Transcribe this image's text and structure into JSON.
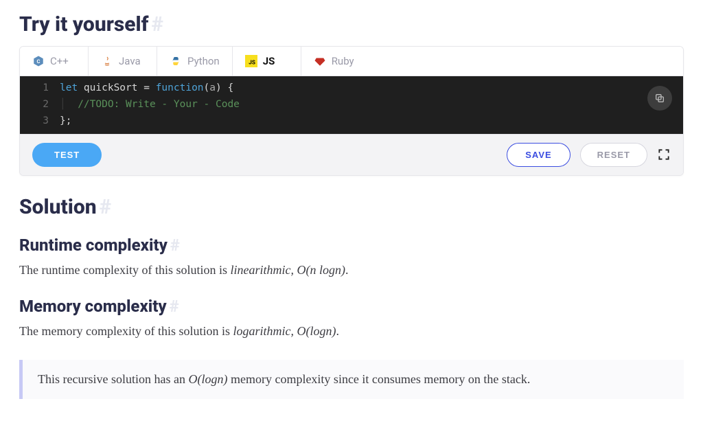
{
  "try_heading": "Try it yourself",
  "tabs": {
    "cpp": "C++",
    "java": "Java",
    "python": "Python",
    "js": "JS",
    "ruby": "Ruby"
  },
  "code": {
    "l1_kw1": "let",
    "l1_name": " quickSort ",
    "l1_eq": "= ",
    "l1_kw2": "function",
    "l1_paren_open": "(",
    "l1_arg": "a",
    "l1_paren_close": ") {",
    "l2_guide": "│  ",
    "l2_comment": "//TODO: Write - Your - Code",
    "l3": "};"
  },
  "buttons": {
    "test": "TEST",
    "save": "SAVE",
    "reset": "RESET"
  },
  "solution_heading": "Solution",
  "runtime_heading": "Runtime complexity",
  "runtime_text_pre": "The runtime complexity of this solution is ",
  "runtime_em": "linearithmic, ",
  "runtime_math": "O(n logn)",
  "runtime_dot": ".",
  "memory_heading": "Memory complexity",
  "memory_text_pre": "The memory complexity of this solution is ",
  "memory_em": "logarithmic, ",
  "memory_math": "O(logn)",
  "memory_dot": ".",
  "callout_pre": "This recursive solution has an ",
  "callout_math": "O(logn)",
  "callout_post": " memory complexity since it consumes memory on the stack."
}
